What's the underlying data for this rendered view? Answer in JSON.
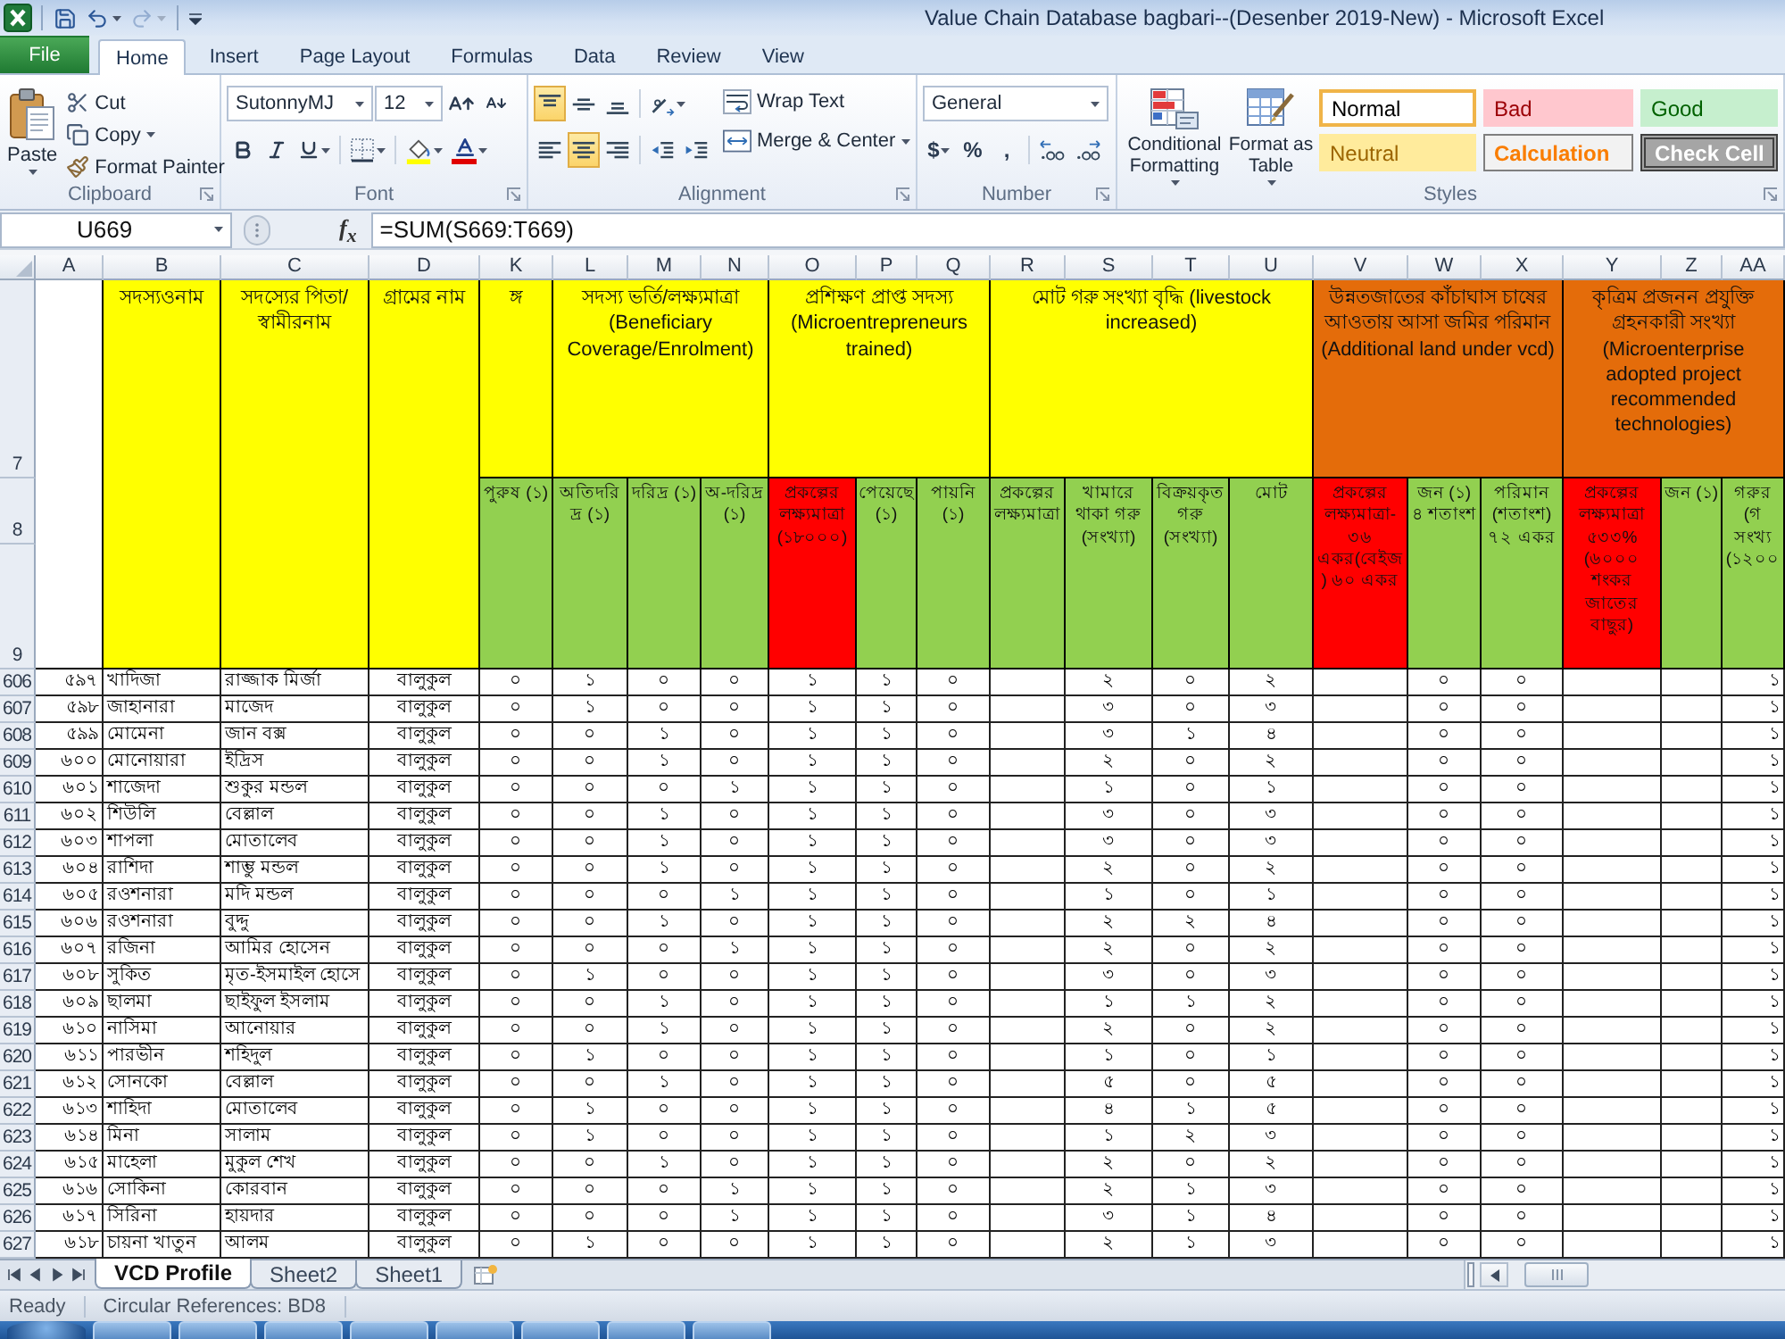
{
  "window": {
    "title": "Value Chain Database bagbari--(Desenber 2019-New) - Microsoft Excel"
  },
  "quick_access": [
    {
      "kind": "save",
      "disabled": false
    },
    {
      "kind": "undo",
      "disabled": false
    },
    {
      "kind": "redo",
      "disabled": true
    },
    {
      "kind": "customize",
      "disabled": false
    }
  ],
  "ribbon_tabs": [
    {
      "label": "File",
      "kind": "file",
      "selected": false
    },
    {
      "label": "Home",
      "kind": "tab",
      "selected": true
    },
    {
      "label": "Insert",
      "kind": "tab",
      "selected": false
    },
    {
      "label": "Page Layout",
      "kind": "tab",
      "selected": false
    },
    {
      "label": "Formulas",
      "kind": "tab",
      "selected": false
    },
    {
      "label": "Data",
      "kind": "tab",
      "selected": false
    },
    {
      "label": "Review",
      "kind": "tab",
      "selected": false
    },
    {
      "label": "View",
      "kind": "tab",
      "selected": false
    }
  ],
  "clipboard": {
    "label": "Clipboard",
    "paste": "Paste",
    "cut": "Cut",
    "copy": "Copy",
    "format_painter": "Format Painter"
  },
  "font": {
    "label": "Font",
    "name": "SutonnyMJ",
    "size": "12"
  },
  "alignment": {
    "label": "Alignment",
    "buttons": [
      {
        "kind": "align-top",
        "selected": true
      },
      {
        "kind": "align-middle",
        "selected": false
      },
      {
        "kind": "align-bottom",
        "selected": false
      },
      {
        "kind": "align-left",
        "selected": false
      },
      {
        "kind": "align-center",
        "selected": true
      },
      {
        "kind": "align-right",
        "selected": false
      }
    ],
    "wrap_text": "Wrap Text",
    "merge_center": "Merge & Center"
  },
  "number": {
    "label": "Number",
    "format": "General",
    "currency": "$",
    "percent": "%",
    "comma": ","
  },
  "styles": {
    "label": "Styles",
    "conditional_formatting": "Conditional Formatting",
    "format_as_table": "Format as Table",
    "cell_styles": [
      {
        "label": "Normal",
        "kind": "normal",
        "color": "#ffffff",
        "selected": true
      },
      {
        "label": "Bad",
        "kind": "bad",
        "color": "#ffc7ce",
        "selected": false
      },
      {
        "label": "Good",
        "kind": "good",
        "color": "#c6efce",
        "selected": false
      },
      {
        "label": "Neutral",
        "kind": "neutral",
        "color": "#ffeb9c",
        "selected": false
      },
      {
        "label": "Calculation",
        "kind": "calculation",
        "color": "#f2f2f2",
        "selected": false
      },
      {
        "label": "Check Cell",
        "kind": "check",
        "color": "#a5a5a5",
        "selected": false
      }
    ]
  },
  "formula_bar": {
    "name_box": "U669",
    "function_button": "f$_{x}$",
    "formula": "=SUM(S669:T669)"
  },
  "sheet": {
    "columns": [
      "A",
      "B",
      "C",
      "D",
      "K",
      "L",
      "M",
      "N",
      "O",
      "P",
      "Q",
      "R",
      "S",
      "T",
      "U",
      "V",
      "W",
      "X",
      "Y",
      "Z",
      "AA"
    ],
    "header_rows": [
      "7",
      "8",
      "9"
    ],
    "header_cells": [
      {
        "text": "সদস্যওনাম",
        "color": "#ffff00"
      },
      {
        "text": "সদস্যের পিতা/স্বামীরনাম",
        "color": "#ffff00"
      },
      {
        "text": "গ্রামের নাম",
        "color": "#ffff00"
      },
      {
        "text": "ঙ্গ",
        "color": "#ffff00",
        "children": [
          {
            "text": "পুরুষ (১)",
            "color": "#92d050"
          }
        ]
      },
      {
        "text": "সদস্য ভর্তি/লক্ষ্যমাত্রা (Beneficiary Coverage/Enrolment)",
        "color": "#ffff00",
        "children": [
          {
            "text": "অতিদরিদ্র (১)",
            "color": "#92d050"
          },
          {
            "text": "দরিদ্র (১)",
            "color": "#92d050"
          },
          {
            "text": "অ-দরিদ্র (১)",
            "color": "#92d050"
          }
        ]
      },
      {
        "text": "প্রশিক্ষণ প্রাপ্ত সদস্য (Microentrepreneurs trained)",
        "color": "#ffff00",
        "children": [
          {
            "text": "প্রকল্পের লক্ষ্যমাত্রা (১৮০০০)",
            "color": "#ff0000"
          },
          {
            "text": "পেয়েছে (১)",
            "color": "#92d050"
          },
          {
            "text": "পায়নি (১)",
            "color": "#92d050"
          }
        ]
      },
      {
        "text": "মোট গরু সংখ্যা বৃদ্ধি (livestock increased)",
        "color": "#ffff00",
        "children": [
          {
            "text": "প্রকল্পের লক্ষ্যমাত্রা",
            "color": "#92d050"
          },
          {
            "text": "খামারে থাকা গরু (সংখ্যা)",
            "color": "#92d050"
          },
          {
            "text": "বিক্রয়কৃত গরু (সংখ্যা)",
            "color": "#92d050"
          },
          {
            "text": "মোট",
            "color": "#92d050"
          }
        ]
      },
      {
        "text": "উন্নতজাতের কাঁচাঘাস চাষের আওতায় আসা জমির পরিমান (Additional land under vcd)",
        "color": "#e46c0a",
        "children": [
          {
            "text": "প্রকল্পের লক্ষ্যমাত্রা- ৩৬ একর(বেইজ ) ৬০ একর",
            "color": "#ff0000"
          },
          {
            "text": "জন (১) ৪ শতাংশ",
            "color": "#92d050"
          },
          {
            "text": "পরিমান (শতাংশ) ৭২ একর",
            "color": "#92d050"
          }
        ]
      },
      {
        "text": "কৃত্রিম প্রজনন প্রযুক্তি গ্রহনকারী সংখ্যা (Microenterprise adopted project recommended technologies)",
        "color": "#e46c0a",
        "children": [
          {
            "text": "প্রকল্পের লক্ষ্যমাত্রা ৫৩৩% (৬০০০ শংকর জাতের বাছুর)",
            "color": "#ff0000"
          },
          {
            "text": "জন (১)",
            "color": "#92d050"
          },
          {
            "text": "গরুর (গ সংখ্য (১২০০",
            "color": "#92d050"
          }
        ]
      }
    ],
    "rows": [
      {
        "number": "606",
        "cells": [
          "৫৯৭",
          "খাদিজা",
          "রাজ্জাক মির্জা",
          "বালুকুল",
          "০",
          "১",
          "০",
          "০",
          "১",
          "১",
          "০",
          null,
          "২",
          "০",
          "২",
          null,
          "০",
          "০",
          null,
          null,
          "১"
        ]
      },
      {
        "number": "607",
        "cells": [
          "৫৯৮",
          "জাহানারা",
          "মাজেদ",
          "বালুকুল",
          "০",
          "১",
          "০",
          "০",
          "১",
          "১",
          "০",
          null,
          "৩",
          "০",
          "৩",
          null,
          "০",
          "০",
          null,
          null,
          "১"
        ]
      },
      {
        "number": "608",
        "cells": [
          "৫৯৯",
          "মোমেনা",
          "জান বক্স",
          "বালুকুল",
          "০",
          "০",
          "১",
          "০",
          "১",
          "১",
          "০",
          null,
          "৩",
          "১",
          "৪",
          null,
          "০",
          "০",
          null,
          null,
          "১"
        ]
      },
      {
        "number": "609",
        "cells": [
          "৬০০",
          "মোনোয়ারা",
          "ইদ্রিস",
          "বালুকুল",
          "০",
          "০",
          "১",
          "০",
          "১",
          "১",
          "০",
          null,
          "২",
          "০",
          "২",
          null,
          "০",
          "০",
          null,
          null,
          "১"
        ]
      },
      {
        "number": "610",
        "cells": [
          "৬০১",
          "শাজেদা",
          "শুকুর মন্ডল",
          "বালুকুল",
          "০",
          "০",
          "০",
          "১",
          "১",
          "১",
          "০",
          null,
          "১",
          "০",
          "১",
          null,
          "০",
          "০",
          null,
          null,
          "১"
        ]
      },
      {
        "number": "611",
        "cells": [
          "৬০২",
          "শিউলি",
          "বেল্লাল",
          "বালুকুল",
          "০",
          "০",
          "১",
          "০",
          "১",
          "১",
          "০",
          null,
          "৩",
          "০",
          "৩",
          null,
          "০",
          "০",
          null,
          null,
          "১"
        ]
      },
      {
        "number": "612",
        "cells": [
          "৬০৩",
          "শাপলা",
          "মোতালেব",
          "বালুকুল",
          "০",
          "০",
          "১",
          "০",
          "১",
          "১",
          "০",
          null,
          "৩",
          "০",
          "৩",
          null,
          "০",
          "০",
          null,
          null,
          "১"
        ]
      },
      {
        "number": "613",
        "cells": [
          "৬০৪",
          "রাশিদা",
          "শাম্ভু মন্ডল",
          "বালুকুল",
          "০",
          "০",
          "১",
          "০",
          "১",
          "১",
          "০",
          null,
          "২",
          "০",
          "২",
          null,
          "০",
          "০",
          null,
          null,
          "১"
        ]
      },
      {
        "number": "614",
        "cells": [
          "৬০৫",
          "রওশনারা",
          "মদি মন্ডল",
          "বালুকুল",
          "০",
          "০",
          "০",
          "১",
          "১",
          "১",
          "০",
          null,
          "১",
          "০",
          "১",
          null,
          "০",
          "০",
          null,
          null,
          "১"
        ]
      },
      {
        "number": "615",
        "cells": [
          "৬০৬",
          "রওশনারা",
          "বুদ্দু",
          "বালুকুল",
          "০",
          "০",
          "১",
          "০",
          "১",
          "১",
          "০",
          null,
          "২",
          "২",
          "৪",
          null,
          "০",
          "০",
          null,
          null,
          "১"
        ]
      },
      {
        "number": "616",
        "cells": [
          "৬০৭",
          "রজিনা",
          "আমির হোসেন",
          "বালুকুল",
          "০",
          "০",
          "০",
          "১",
          "১",
          "১",
          "০",
          null,
          "২",
          "০",
          "২",
          null,
          "০",
          "০",
          null,
          null,
          "১"
        ]
      },
      {
        "number": "617",
        "cells": [
          "৬০৮",
          "সুকিত",
          "মৃত-ইসমাইল হোসে",
          "বালুকুল",
          "০",
          "১",
          "০",
          "০",
          "১",
          "১",
          "০",
          null,
          "৩",
          "০",
          "৩",
          null,
          "০",
          "০",
          null,
          null,
          "১"
        ]
      },
      {
        "number": "618",
        "cells": [
          "৬০৯",
          "ছালমা",
          "ছাইফুল ইসলাম",
          "বালুকুল",
          "০",
          "০",
          "১",
          "০",
          "১",
          "১",
          "০",
          null,
          "১",
          "১",
          "২",
          null,
          "০",
          "০",
          null,
          null,
          "১"
        ]
      },
      {
        "number": "619",
        "cells": [
          "৬১০",
          "নাসিমা",
          "আনোয়ার",
          "বালুকুল",
          "০",
          "০",
          "১",
          "০",
          "১",
          "১",
          "০",
          null,
          "২",
          "০",
          "২",
          null,
          "০",
          "০",
          null,
          null,
          "১"
        ]
      },
      {
        "number": "620",
        "cells": [
          "৬১১",
          "পারভীন",
          "শহিদুল",
          "বালুকুল",
          "০",
          "১",
          "০",
          "০",
          "১",
          "১",
          "০",
          null,
          "১",
          "০",
          "১",
          null,
          "০",
          "০",
          null,
          null,
          "১"
        ]
      },
      {
        "number": "621",
        "cells": [
          "৬১২",
          "সোনকো",
          "বেল্লাল",
          "বালুকুল",
          "০",
          "০",
          "১",
          "০",
          "১",
          "১",
          "০",
          null,
          "৫",
          "০",
          "৫",
          null,
          "০",
          "০",
          null,
          null,
          "১"
        ]
      },
      {
        "number": "622",
        "cells": [
          "৬১৩",
          "শাহিদা",
          "মোতালেব",
          "বালুকুল",
          "০",
          "১",
          "০",
          "০",
          "১",
          "১",
          "০",
          null,
          "৪",
          "১",
          "৫",
          null,
          "০",
          "০",
          null,
          null,
          "১"
        ]
      },
      {
        "number": "623",
        "cells": [
          "৬১৪",
          "মিনা",
          "সালাম",
          "বালুকুল",
          "০",
          "১",
          "০",
          "০",
          "১",
          "১",
          "০",
          null,
          "১",
          "২",
          "৩",
          null,
          "০",
          "০",
          null,
          null,
          "১"
        ]
      },
      {
        "number": "624",
        "cells": [
          "৬১৫",
          "মাহেলা",
          "মুকুল শেখ",
          "বালুকুল",
          "০",
          "০",
          "১",
          "০",
          "১",
          "১",
          "০",
          null,
          "২",
          "০",
          "২",
          null,
          "০",
          "০",
          null,
          null,
          "১"
        ]
      },
      {
        "number": "625",
        "cells": [
          "৬১৬",
          "সোকিনা",
          "কোরবান",
          "বালুকুল",
          "০",
          "০",
          "০",
          "১",
          "১",
          "১",
          "০",
          null,
          "২",
          "১",
          "৩",
          null,
          "০",
          "০",
          null,
          null,
          "১"
        ]
      },
      {
        "number": "626",
        "cells": [
          "৬১৭",
          "সিরিনা",
          "হায়দার",
          "বালুকুল",
          "০",
          "০",
          "০",
          "১",
          "১",
          "১",
          "০",
          null,
          "৩",
          "১",
          "৪",
          null,
          "০",
          "০",
          null,
          null,
          "১"
        ]
      },
      {
        "number": "627",
        "cells": [
          "৬১৮",
          "চায়না খাতুন",
          "আলম",
          "বালুকুল",
          "০",
          "১",
          "০",
          "০",
          "১",
          "১",
          "০",
          null,
          "২",
          "১",
          "৩",
          null,
          "০",
          "০",
          null,
          null,
          "১"
        ]
      }
    ]
  },
  "sheet_tabs": [
    {
      "label": "VCD Profile",
      "selected": true
    },
    {
      "label": "Sheet2",
      "selected": false
    },
    {
      "label": "Sheet1",
      "selected": false
    }
  ],
  "status_bar": {
    "mode": "Ready",
    "circular_references": "Circular References: BD8"
  }
}
